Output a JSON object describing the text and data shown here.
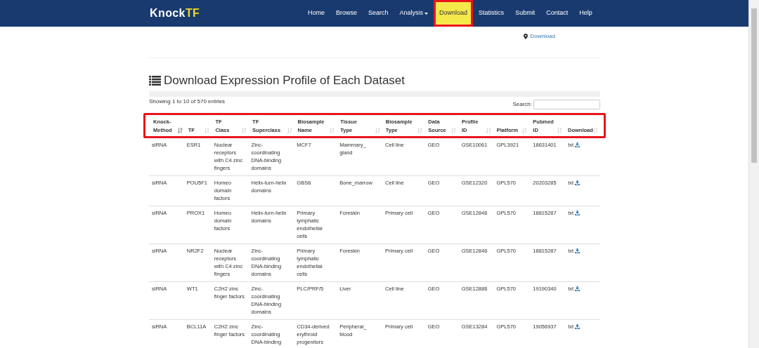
{
  "navbar": {
    "logo": [
      "Knock",
      "TF"
    ],
    "items": [
      {
        "label": "Home",
        "selected": false,
        "highlighted": false,
        "dropdown": false
      },
      {
        "label": "Browse",
        "selected": false,
        "highlighted": false,
        "dropdown": false
      },
      {
        "label": "Search",
        "selected": false,
        "highlighted": false,
        "dropdown": false
      },
      {
        "label": "Analysis",
        "selected": false,
        "highlighted": false,
        "dropdown": true
      },
      {
        "label": "Download",
        "selected": true,
        "highlighted": true,
        "dropdown": false
      },
      {
        "label": "Statistics",
        "selected": false,
        "highlighted": false,
        "dropdown": false
      },
      {
        "label": "Submit",
        "selected": false,
        "highlighted": false,
        "dropdown": false
      },
      {
        "label": "Contact",
        "selected": false,
        "highlighted": false,
        "dropdown": false
      },
      {
        "label": "Help",
        "selected": false,
        "highlighted": false,
        "dropdown": false
      }
    ]
  },
  "breadcrumb": "Download",
  "heading": "Download Expression Profile of Each Dataset",
  "table": {
    "info": "Showing 1 to 10 of 570 entries",
    "search_label": "Search:",
    "header_highlighted": true,
    "columns": [
      {
        "label": "Knock- Method",
        "sorted": true
      },
      {
        "label": "TF",
        "sorted": false
      },
      {
        "label": "TF Class",
        "sorted": false
      },
      {
        "label": "TF Superclass",
        "sorted": false
      },
      {
        "label": "Biosample Name",
        "sorted": false
      },
      {
        "label": "Tissue Type",
        "sorted": false
      },
      {
        "label": "Biosample Type",
        "sorted": false
      },
      {
        "label": "Data Source",
        "sorted": false
      },
      {
        "label": "Profile ID",
        "sorted": false
      },
      {
        "label": "Platform",
        "sorted": false
      },
      {
        "label": "Pubmed ID",
        "sorted": false
      },
      {
        "label": "Download",
        "sorted": false
      }
    ],
    "rows": [
      [
        "siRNA",
        "ESR1",
        "Nuclear receptors with C4 zinc fingers",
        "Zinc-coordinating DNA-binding domains",
        "MCF7",
        "Mammary_ gland",
        "Cell line",
        "GEO",
        "GSE10061",
        "GPL3921",
        "18631401",
        "txt"
      ],
      [
        "siRNA",
        "POU5F1",
        "Homeo domain factors",
        "Helix-turn-helix domains",
        "GBS6",
        "Bone_marrow",
        "Cell line",
        "GEO",
        "GSE12320",
        "GPL570",
        "20203285",
        "txt"
      ],
      [
        "siRNA",
        "PROX1",
        "Homeo domain factors",
        "Helix-turn-helix domains",
        "Primary lymphatic endothelial cells",
        "Foreskin",
        "Primary cell",
        "GEO",
        "GSE12846",
        "GPL570",
        "18815287",
        "txt"
      ],
      [
        "siRNA",
        "NR2F2",
        "Nuclear receptors with C4 zinc fingers",
        "Zinc-coordinating DNA-binding domains",
        "Primary lymphatic endothelial cells",
        "Foreskin",
        "Primary cell",
        "GEO",
        "GSE12846",
        "GPL570",
        "18815287",
        "txt"
      ],
      [
        "siRNA",
        "WT1",
        "C2H2 zinc finger factors",
        "Zinc-coordinating DNA-binding domains",
        "PLC/PRF/5",
        "Liver",
        "Cell line",
        "GEO",
        "GSE12886",
        "GPL570",
        "19190340",
        "txt"
      ],
      [
        "siRNA",
        "BCL11A",
        "C2H2 zinc finger factors",
        "Zinc-coordinating DNA-binding",
        "CD34-derived erythroid progenitors",
        "Peripheral_ blood",
        "Primary cell",
        "GEO",
        "GSE13284",
        "GPL570",
        "19056937",
        "txt"
      ]
    ]
  }
}
